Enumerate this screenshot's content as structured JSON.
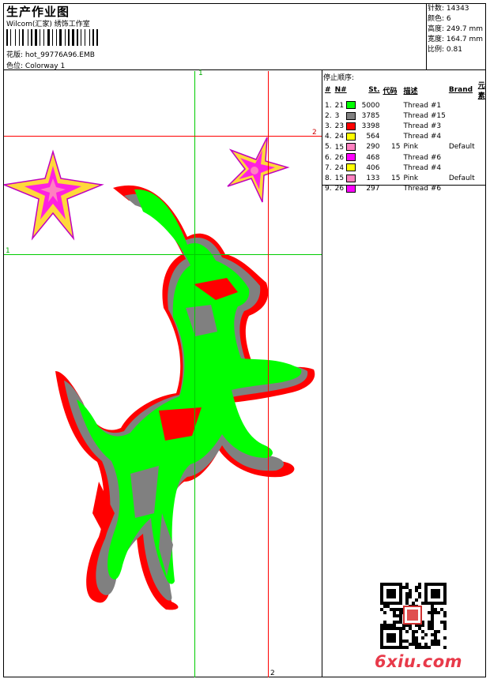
{
  "header": {
    "title": "生产作业图",
    "studio": "Wilcom(汇家) 绣饰工作室",
    "pattern_label": "花版:",
    "pattern_file": "hot_99776A96.EMB",
    "colorway_label": "色位:",
    "colorway": "Colorway 1"
  },
  "stats": {
    "stitches": "针数: 14343",
    "colors": "颜色: 6",
    "height": "高度: 249.7 mm",
    "width": "宽度: 164.7 mm",
    "scale": "比例: 0.81"
  },
  "sequence": {
    "title": "停止顺序:",
    "headers": {
      "num": "#",
      "n": "N#",
      "st": "St.",
      "code": "代码",
      "desc": "描述",
      "brand": "Brand",
      "element": "元素"
    },
    "rows": [
      {
        "idx": "1.",
        "n": "21",
        "color": "#00ff00",
        "st": "5000",
        "code": "",
        "desc": "Thread #1",
        "brand": ""
      },
      {
        "idx": "2.",
        "n": "3",
        "color": "#808080",
        "st": "3785",
        "code": "",
        "desc": "Thread #15",
        "brand": ""
      },
      {
        "idx": "3.",
        "n": "23",
        "color": "#ff0000",
        "st": "3398",
        "code": "",
        "desc": "Thread #3",
        "brand": ""
      },
      {
        "idx": "4.",
        "n": "24",
        "color": "#ffff00",
        "st": "564",
        "code": "",
        "desc": "Thread #4",
        "brand": ""
      },
      {
        "idx": "5.",
        "n": "15",
        "color": "#ff80c0",
        "st": "290",
        "code": "15",
        "desc": "Pink",
        "brand": "Default"
      },
      {
        "idx": "6.",
        "n": "26",
        "color": "#ff00ff",
        "st": "468",
        "code": "",
        "desc": "Thread #6",
        "brand": ""
      },
      {
        "idx": "7.",
        "n": "24",
        "color": "#ffff00",
        "st": "406",
        "code": "",
        "desc": "Thread #4",
        "brand": ""
      },
      {
        "idx": "8.",
        "n": "15",
        "color": "#ff80c0",
        "st": "133",
        "code": "15",
        "desc": "Pink",
        "brand": "Default"
      },
      {
        "idx": "9.",
        "n": "26",
        "color": "#ff00ff",
        "st": "297",
        "code": "",
        "desc": "Thread #6",
        "brand": ""
      }
    ]
  },
  "guides": {
    "green_v_label": "1",
    "green_h_label": "1",
    "red_v_label": "2",
    "red_h_label": "2",
    "green_color": "#00cc00",
    "red_color": "#ff0000"
  },
  "watermark": "6xiu.com",
  "colors": {
    "green": "#00ff00",
    "gray": "#808080",
    "red": "#ff0000",
    "yellow": "#ffd83a",
    "magenta": "#ff00ff",
    "watermark": "#e83a4a"
  }
}
